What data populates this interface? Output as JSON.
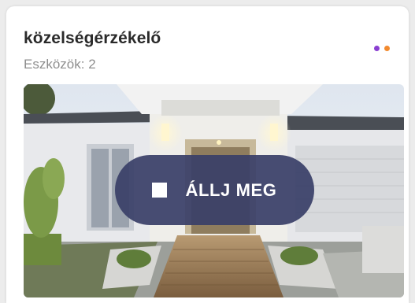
{
  "card": {
    "title": "közelségérzékelő",
    "subtitle": "Eszközök: 2",
    "menu_dots": [
      "#8a3fd1",
      "#f28a2e"
    ]
  },
  "scene": {
    "image_icon": "house-photo"
  },
  "action": {
    "label": "ÁLLJ MEG",
    "icon": "stop-icon",
    "color": "#3a4068"
  }
}
